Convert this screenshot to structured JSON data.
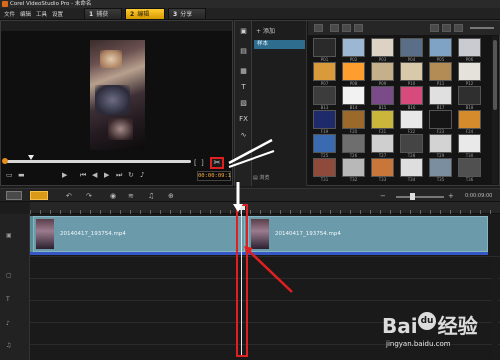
{
  "window": {
    "title": "Corel VideoStudio Pro - 未命名"
  },
  "menu": {
    "items": [
      "文件",
      "编辑",
      "工具",
      "设置"
    ]
  },
  "steps": [
    {
      "num": "1",
      "label": "捕获",
      "active": false
    },
    {
      "num": "2",
      "label": "编辑",
      "active": true
    },
    {
      "num": "3",
      "label": "分享",
      "active": false
    }
  ],
  "preview": {
    "timecode": "00:00:09:1",
    "playback_progress": 0.15,
    "split_icon": "scissors-icon"
  },
  "library": {
    "add_label": "添加",
    "selected_folder": "样本",
    "browse_label": "浏览",
    "thumb_labels": [
      "P01",
      "P02",
      "P03",
      "P04",
      "P05",
      "P06",
      "P07",
      "P08",
      "P09",
      "P10",
      "P11",
      "P12",
      "B13",
      "B14",
      "B15",
      "B16",
      "B17",
      "B18",
      "F19",
      "F20",
      "F21",
      "F22",
      "F23",
      "F24",
      "T25",
      "T26",
      "T27",
      "T28",
      "T29",
      "T30",
      "T31",
      "T32",
      "T33",
      "T34",
      "T35",
      "T36"
    ]
  },
  "timeline": {
    "time": "0:00:09:00",
    "clip1_name": "20140417_193754.mp4",
    "clip2_name": "20140417_193754.mp4"
  },
  "watermark": {
    "logo": "Bai",
    "logo2": "经验",
    "url": "jingyan.baidu.com"
  },
  "colors": {
    "accent": "#e02020",
    "active_step": "#ffcc33",
    "clip": "#6b9bab",
    "audio": "#3557c6"
  }
}
